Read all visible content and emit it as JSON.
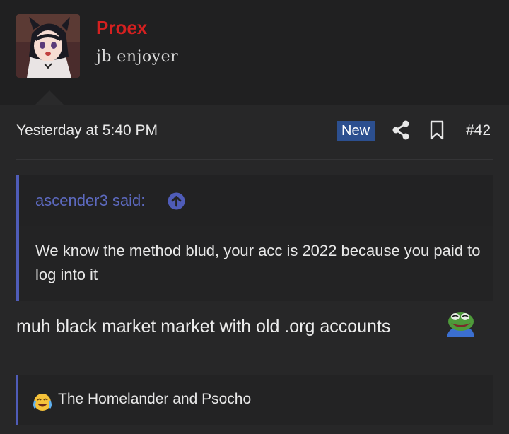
{
  "user": {
    "name": "Proex",
    "title": "jb enjoyer",
    "name_color": "#d42020"
  },
  "post": {
    "timestamp": "Yesterday at 5:40 PM",
    "new_badge": "New",
    "number": "#42",
    "icons": [
      "share-icon",
      "bookmark-icon"
    ],
    "quote": {
      "author": "ascender3 said:",
      "body": "We know the method blud, your acc is 2022 because you paid to log into it",
      "icon": "arrow-up-circle-icon"
    },
    "message": "muh black market market with old .org accounts",
    "message_emoji": "pepe-laugh-icon",
    "signature": {
      "icon": "crying-laughing-icon",
      "text": "The Homelander and Psocho"
    }
  },
  "colors": {
    "accent": "#4f5cb8",
    "badge": "#2c4f8f",
    "background": "#272728"
  }
}
